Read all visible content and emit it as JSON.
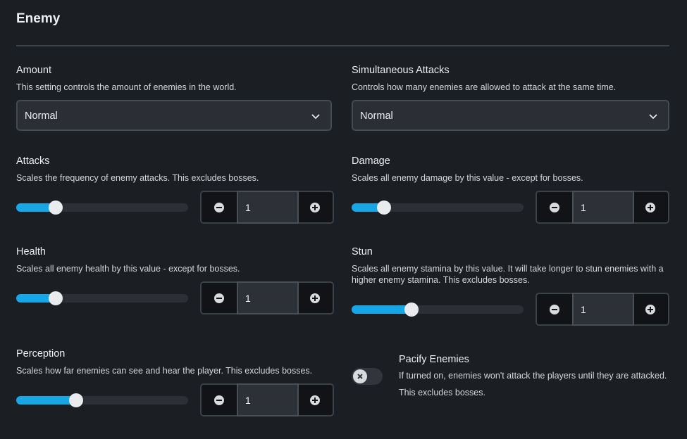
{
  "section": {
    "title": "Enemy"
  },
  "amount": {
    "label": "Amount",
    "description": "This setting controls the amount of enemies in the world.",
    "value": "Normal"
  },
  "simultaneous": {
    "label": "Simultaneous Attacks",
    "description": "Controls how many enemies are allowed to attack at the same time.",
    "value": "Normal"
  },
  "attacks": {
    "label": "Attacks",
    "description": "Scales the frequency of enemy attacks. This excludes bosses.",
    "value": "1",
    "slider_fraction": 0.23
  },
  "damage": {
    "label": "Damage",
    "description": "Scales all enemy damage by this value - except for bosses.",
    "value": "1",
    "slider_fraction": 0.19
  },
  "health": {
    "label": "Health",
    "description": "Scales all enemy health by this value - except for bosses.",
    "value": "1",
    "slider_fraction": 0.23
  },
  "stun": {
    "label": "Stun",
    "description": "Scales all enemy stamina by this value. It will take longer to stun enemies with a higher enemy stamina. This excludes bosses.",
    "value": "1",
    "slider_fraction": 0.35
  },
  "perception": {
    "label": "Perception",
    "description": "Scales how far enemies can see and hear the player. This excludes bosses.",
    "value": "1",
    "slider_fraction": 0.35
  },
  "pacify": {
    "label": "Pacify Enemies",
    "description": "If turned on, enemies won't attack the players until they are attacked. This excludes bosses.",
    "enabled": false
  },
  "colors": {
    "accent": "#17a7e6",
    "background": "#1b1e22"
  },
  "icons": {
    "dropdown": "chevron-down-icon",
    "decrement": "minus-circle-icon",
    "increment": "plus-circle-icon",
    "toggle_off": "x-icon"
  }
}
